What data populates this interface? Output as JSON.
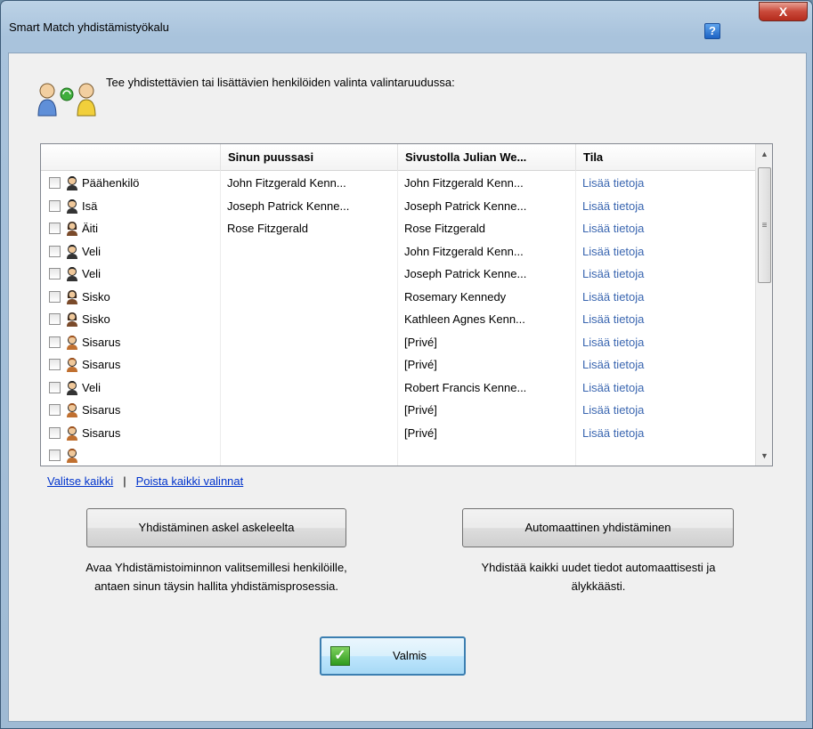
{
  "window": {
    "title": "Smart Match yhdistämistyökalu",
    "help_glyph": "?",
    "close_glyph": "X"
  },
  "intro": {
    "text": "Tee yhdistettävien tai lisättävien henkilöiden valinta valintaruudussa:",
    "icon": "people-merge-icon"
  },
  "grid": {
    "columns": [
      "",
      "Sinun puussasi",
      "Sivustolla Julian We...",
      "Tila"
    ],
    "rows": [
      {
        "relation": "Päähenkilö",
        "gender": "male",
        "tree": "John Fitzgerald Kenn...",
        "site": "John Fitzgerald Kenn...",
        "status": "Lisää tietoja"
      },
      {
        "relation": "Isä",
        "gender": "male",
        "tree": "Joseph Patrick Kenne...",
        "site": "Joseph Patrick Kenne...",
        "status": "Lisää tietoja"
      },
      {
        "relation": "Äiti",
        "gender": "female",
        "tree": "Rose Fitzgerald",
        "site": "Rose Fitzgerald",
        "status": "Lisää tietoja"
      },
      {
        "relation": "Veli",
        "gender": "male",
        "tree": "",
        "site": "John Fitzgerald Kenn...",
        "status": "Lisää tietoja"
      },
      {
        "relation": "Veli",
        "gender": "male",
        "tree": "",
        "site": "Joseph Patrick Kenne...",
        "status": "Lisää tietoja"
      },
      {
        "relation": "Sisko",
        "gender": "female",
        "tree": "",
        "site": "Rosemary Kennedy",
        "status": "Lisää tietoja"
      },
      {
        "relation": "Sisko",
        "gender": "female",
        "tree": "",
        "site": "Kathleen Agnes Kenn...",
        "status": "Lisää tietoja"
      },
      {
        "relation": "Sisarus",
        "gender": "unknown",
        "tree": "",
        "site": "[Privé]",
        "status": "Lisää tietoja"
      },
      {
        "relation": "Sisarus",
        "gender": "unknown",
        "tree": "",
        "site": "[Privé]",
        "status": "Lisää tietoja"
      },
      {
        "relation": "Veli",
        "gender": "male",
        "tree": "",
        "site": "Robert Francis Kenne...",
        "status": "Lisää tietoja"
      },
      {
        "relation": "Sisarus",
        "gender": "unknown",
        "tree": "",
        "site": "[Privé]",
        "status": "Lisää tietoja"
      },
      {
        "relation": "Sisarus",
        "gender": "unknown",
        "tree": "",
        "site": "[Privé]",
        "status": "Lisää tietoja"
      },
      {
        "relation": "",
        "gender": "unknown",
        "tree": "",
        "site": "",
        "status": ""
      }
    ]
  },
  "selection_links": {
    "select_all": "Valitse kaikki",
    "separator": "|",
    "clear_all": "Poista kaikki valinnat"
  },
  "step_merge": {
    "button": "Yhdistäminen askel askeleelta",
    "description_line1": "Avaa Yhdistämistoiminnon valitsemillesi henkilöille,",
    "description_line2": "antaen sinun täysin hallita yhdistämisprosessia."
  },
  "auto_merge": {
    "button": "Automaattinen yhdistäminen",
    "description_line1": "Yhdistää kaikki uudet tiedot automaattisesti ja",
    "description_line2": "älykkäästi."
  },
  "done": {
    "label": "Valmis",
    "icon": "checkmark-icon"
  },
  "colors": {
    "link": "#3a66b0",
    "hyperlink": "#0033cc",
    "done_border": "#3c7fb1",
    "check_green": "#2f9a1e"
  }
}
